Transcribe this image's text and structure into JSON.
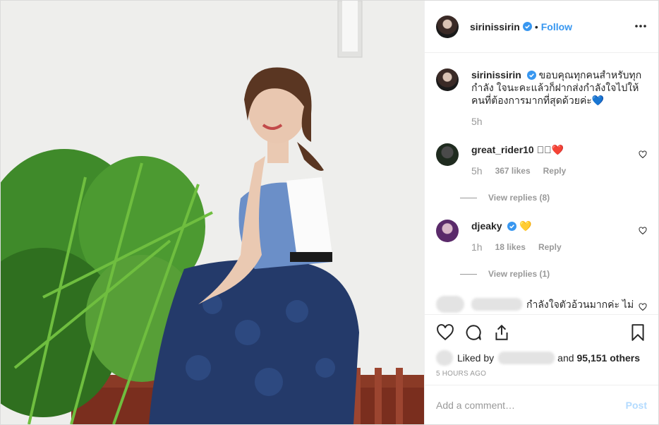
{
  "header": {
    "username": "sirinissirin",
    "separator": "•",
    "follow_label": "Follow"
  },
  "caption": {
    "username": "sirinissirin",
    "text": "ขอบคุณทุกคนสำหรับทุกกำลัง ใจนะคะแล้วก็ฝากส่งกำลังใจไปให้คนที่ต้องการมากที่สุดด้วยค่ะ💙",
    "time": "5h"
  },
  "comments": [
    {
      "username": "great_rider10",
      "text": "◻🏻❤️",
      "time": "5h",
      "likes": "367 likes",
      "reply_label": "Reply",
      "view_replies": "View replies (8)"
    },
    {
      "username": "djeaky",
      "text": "💛",
      "time": "1h",
      "likes": "18 likes",
      "reply_label": "Reply",
      "view_replies": "View replies (1)"
    },
    {
      "username": "",
      "text": "กำลังใจตัวอ้วนมากค่ะ ไม่"
    }
  ],
  "liked_by": {
    "prefix": "Liked by",
    "and_text": "and",
    "others": "95,151 others"
  },
  "timeago": "5 HOURS AGO",
  "add_comment": {
    "placeholder": "Add a comment…",
    "post_label": "Post"
  },
  "colors": {
    "link_blue": "#3897f0",
    "post_disabled": "#b3dbff",
    "muted": "#999999",
    "verified": "#3897f0"
  },
  "icons": [
    "more-icon",
    "verified-icon",
    "heart-icon",
    "comment-icon",
    "share-icon",
    "bookmark-icon"
  ]
}
